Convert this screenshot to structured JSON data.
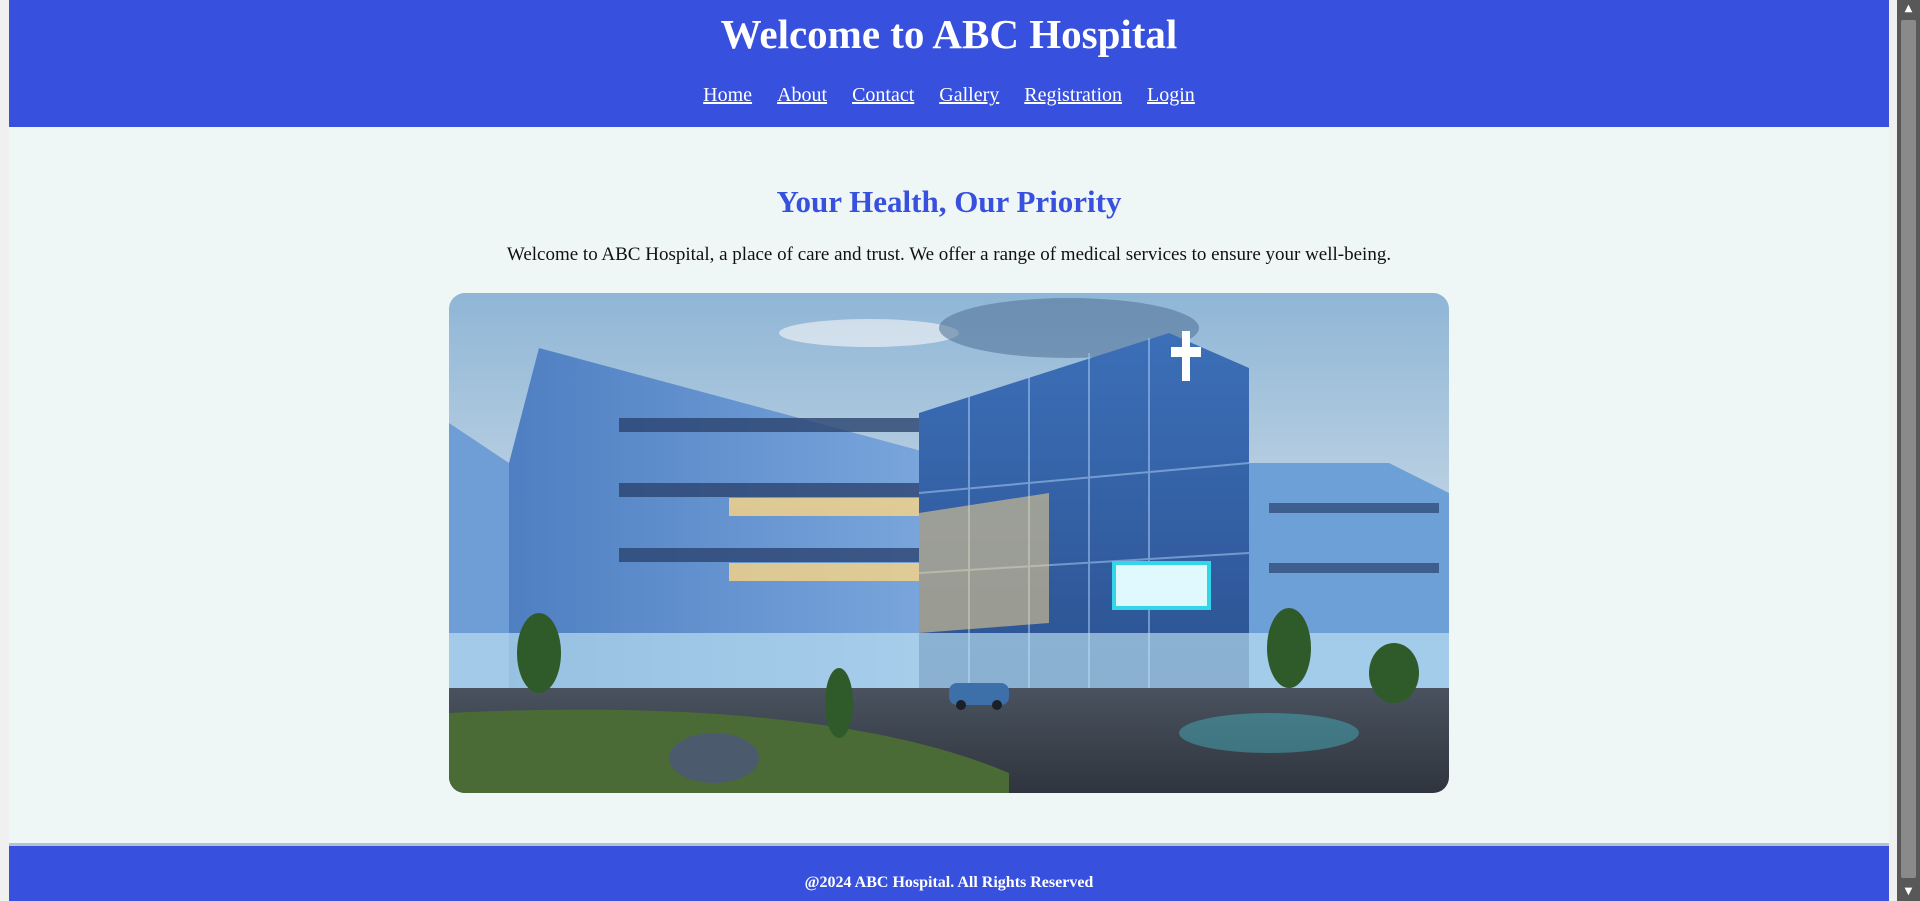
{
  "header": {
    "title": "Welcome to ABC Hospital",
    "nav": [
      "Home",
      "About",
      "Contact",
      "Gallery",
      "Registration",
      "Login"
    ]
  },
  "main": {
    "heading": "Your Health, Our Priority",
    "intro": "Welcome to ABC Hospital, a place of care and trust. We offer a range of medical services to ensure your well-being.",
    "image": {
      "alt": "Modern hospital building at dusk"
    }
  },
  "footer": {
    "text": "@2024 ABC Hospital. All Rights Reserved"
  },
  "colors": {
    "brand_blue": "#3750dd",
    "page_background": "#eff6f6",
    "scrollbar": "#585858"
  },
  "icons": {
    "hospital_sign": "medical-cross-icon",
    "scroll_up": "chevron-up-icon",
    "scroll_down": "chevron-down-icon"
  },
  "scroll": {
    "position": 0
  }
}
